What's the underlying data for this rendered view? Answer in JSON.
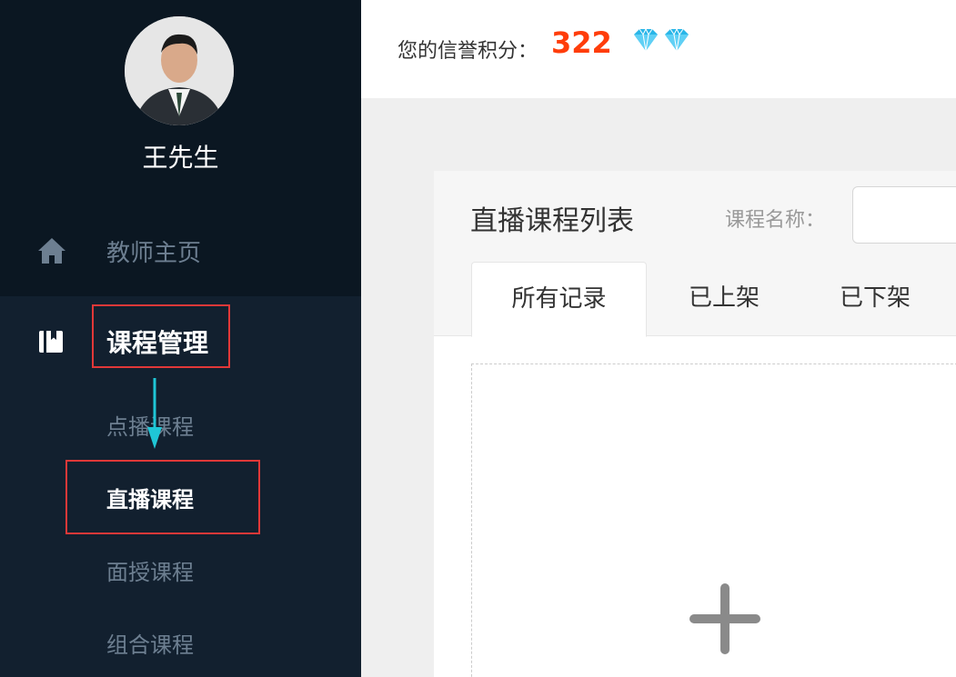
{
  "sidebar": {
    "username": "王先生",
    "home_label": "教师主页",
    "course_mgmt_label": "课程管理",
    "sub_items": {
      "vod": "点播课程",
      "live": "直播课程",
      "f2f": "面授课程",
      "combo": "组合课程"
    }
  },
  "topbar": {
    "credit_label": "您的信誉积分：",
    "credit_value": "322"
  },
  "panel": {
    "title": "直播课程列表",
    "filter_label": "课程名称：",
    "filter_placeholder": "",
    "tabs": [
      "所有记录",
      "已上架",
      "已下架"
    ]
  },
  "colors": {
    "sidebar_bg": "#12202f",
    "sidebar_top_bg": "#0b1722",
    "highlight": "#e13838",
    "credit": "#ff3d0a",
    "arrow": "#1fc6d6"
  },
  "icons": {
    "home": "home-icon",
    "course": "book-icon",
    "diamond": "diamond-icon",
    "add": "plus-icon"
  }
}
